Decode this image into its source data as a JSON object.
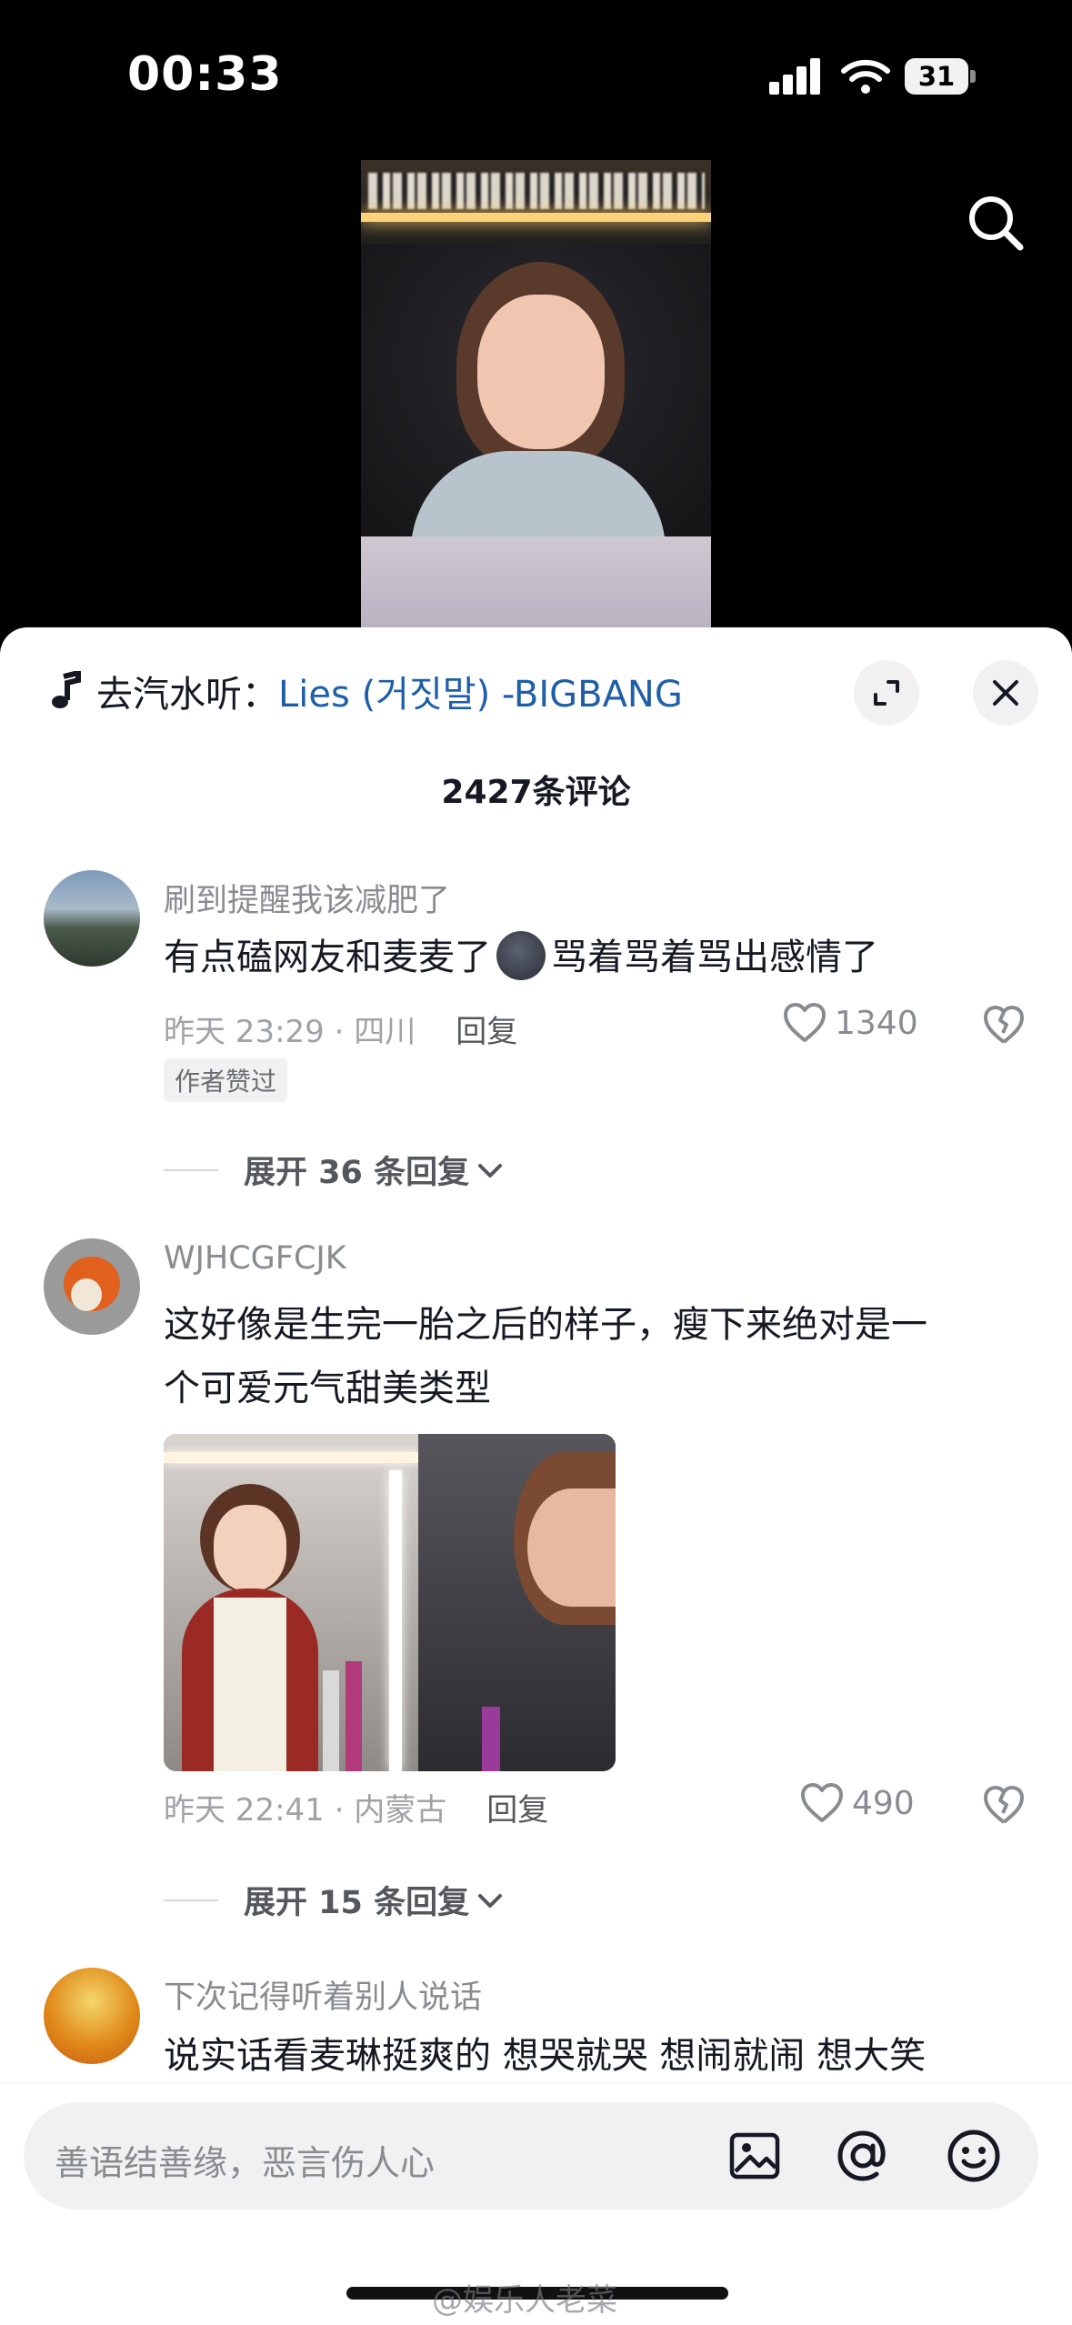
{
  "status_bar": {
    "time": "00:33",
    "battery": "31"
  },
  "music": {
    "prefix": "去汽水听：",
    "song": "Lies (거짓말) -BIGBANG"
  },
  "comments_header": {
    "count_label": "2427条评论"
  },
  "comments": [
    {
      "username": "刷到提醒我该减肥了",
      "text_before": "有点磕网友和麦麦了",
      "text_after": "骂着骂着骂出感情了",
      "time_location": "昨天 23:29 · 四川",
      "reply_label": "回复",
      "likes": "1340",
      "badge": "作者赞过",
      "expand_label": "展开 36 条回复"
    },
    {
      "username": "WJHCGFCJK",
      "text_line1": "这好像是生完一胎之后的样子，瘦下来绝对是一",
      "text_line2": "个可爱元气甜美类型",
      "time_location": "昨天 22:41 · 内蒙古",
      "reply_label": "回复",
      "likes": "490",
      "expand_label": "展开 15 条回复"
    },
    {
      "username": "下次记得听着别人说话",
      "text": "说实话看麦琳挺爽的 想哭就哭 想闹就闹 想大笑"
    }
  ],
  "input": {
    "placeholder": "善语结善缘，恶言伤人心"
  },
  "watermark": "@娱乐人老菜",
  "colors": {
    "link": "#1f5fa8",
    "text": "#161823",
    "muted": "#8a8b91",
    "sheet_bg": "#ffffff",
    "screen_bg": "#000000"
  },
  "icons": [
    "signal-icon",
    "wifi-icon",
    "battery-icon",
    "search-icon",
    "music-note-icon",
    "expand-icon",
    "close-icon",
    "heart-icon",
    "broken-heart-icon",
    "chevron-down-icon",
    "image-icon",
    "at-icon",
    "emoji-icon"
  ]
}
